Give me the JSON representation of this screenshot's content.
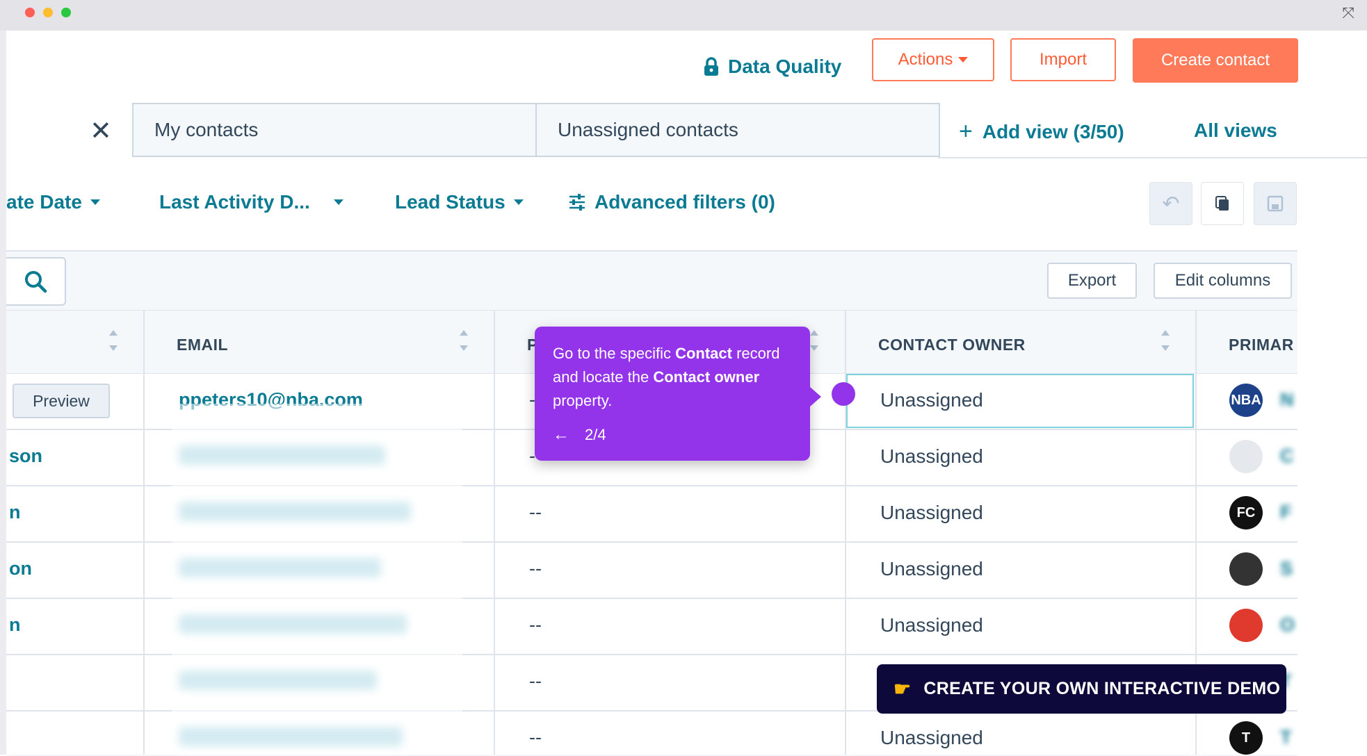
{
  "header": {
    "data_quality_label": "Data Quality",
    "actions_label": "Actions",
    "import_label": "Import",
    "create_contact_label": "Create contact"
  },
  "tabs": {
    "items": [
      {
        "label": "My contacts"
      },
      {
        "label": "Unassigned contacts"
      }
    ],
    "add_view_label": "Add view (3/50)",
    "all_views_label": "All views"
  },
  "filters": {
    "create_date_label": "ate Date",
    "last_activity_label": "Last Activity D...",
    "lead_status_label": "Lead Status",
    "advanced_label": "Advanced filters (0)"
  },
  "table_toolbar": {
    "export_label": "Export",
    "edit_columns_label": "Edit columns"
  },
  "table": {
    "columns": [
      "EMAIL",
      "P",
      "CONTACT OWNER",
      "PRIMAR"
    ],
    "preview_label": "Preview",
    "rows": [
      {
        "name": "",
        "email": "ppeters10@nba.com",
        "phone": "-",
        "owner": "Unassigned",
        "company": "N",
        "logo": "NBA",
        "logo_color": "#1d428a"
      },
      {
        "name": "son",
        "email": "",
        "phone": "-",
        "owner": "Unassigned",
        "company": "C",
        "logo": "",
        "logo_color": "#e5e9ee"
      },
      {
        "name": "n",
        "email": "",
        "phone": "--",
        "owner": "Unassigned",
        "company": "F",
        "logo": "FC",
        "logo_color": "#111111"
      },
      {
        "name": "on",
        "email": "",
        "phone": "--",
        "owner": "Unassigned",
        "company": "S",
        "logo": "",
        "logo_color": "#333333"
      },
      {
        "name": "n",
        "email": "",
        "phone": "--",
        "owner": "Unassigned",
        "company": "O",
        "logo": "",
        "logo_color": "#e03a2f"
      },
      {
        "name": "",
        "email": "",
        "phone": "--",
        "owner": "",
        "company": "T",
        "logo": "",
        "logo_color": "#ffffff"
      },
      {
        "name": "",
        "email": "",
        "phone": "--",
        "owner": "Unassigned",
        "company": "T",
        "logo": "T",
        "logo_color": "#111111"
      }
    ]
  },
  "tooltip": {
    "text_1": "Go to the specific ",
    "text_bold_1": "Contact",
    "text_2": " record and locate the ",
    "text_bold_2": "Contact owner",
    "text_3": " property.",
    "step": "2/4"
  },
  "demo_banner": {
    "label": "CREATE YOUR OWN INTERACTIVE DEMO"
  },
  "colors": {
    "accent": "#ff7a59",
    "link": "#0b7a93",
    "tooltip": "#9333ea",
    "banner": "#0d0a3b"
  }
}
